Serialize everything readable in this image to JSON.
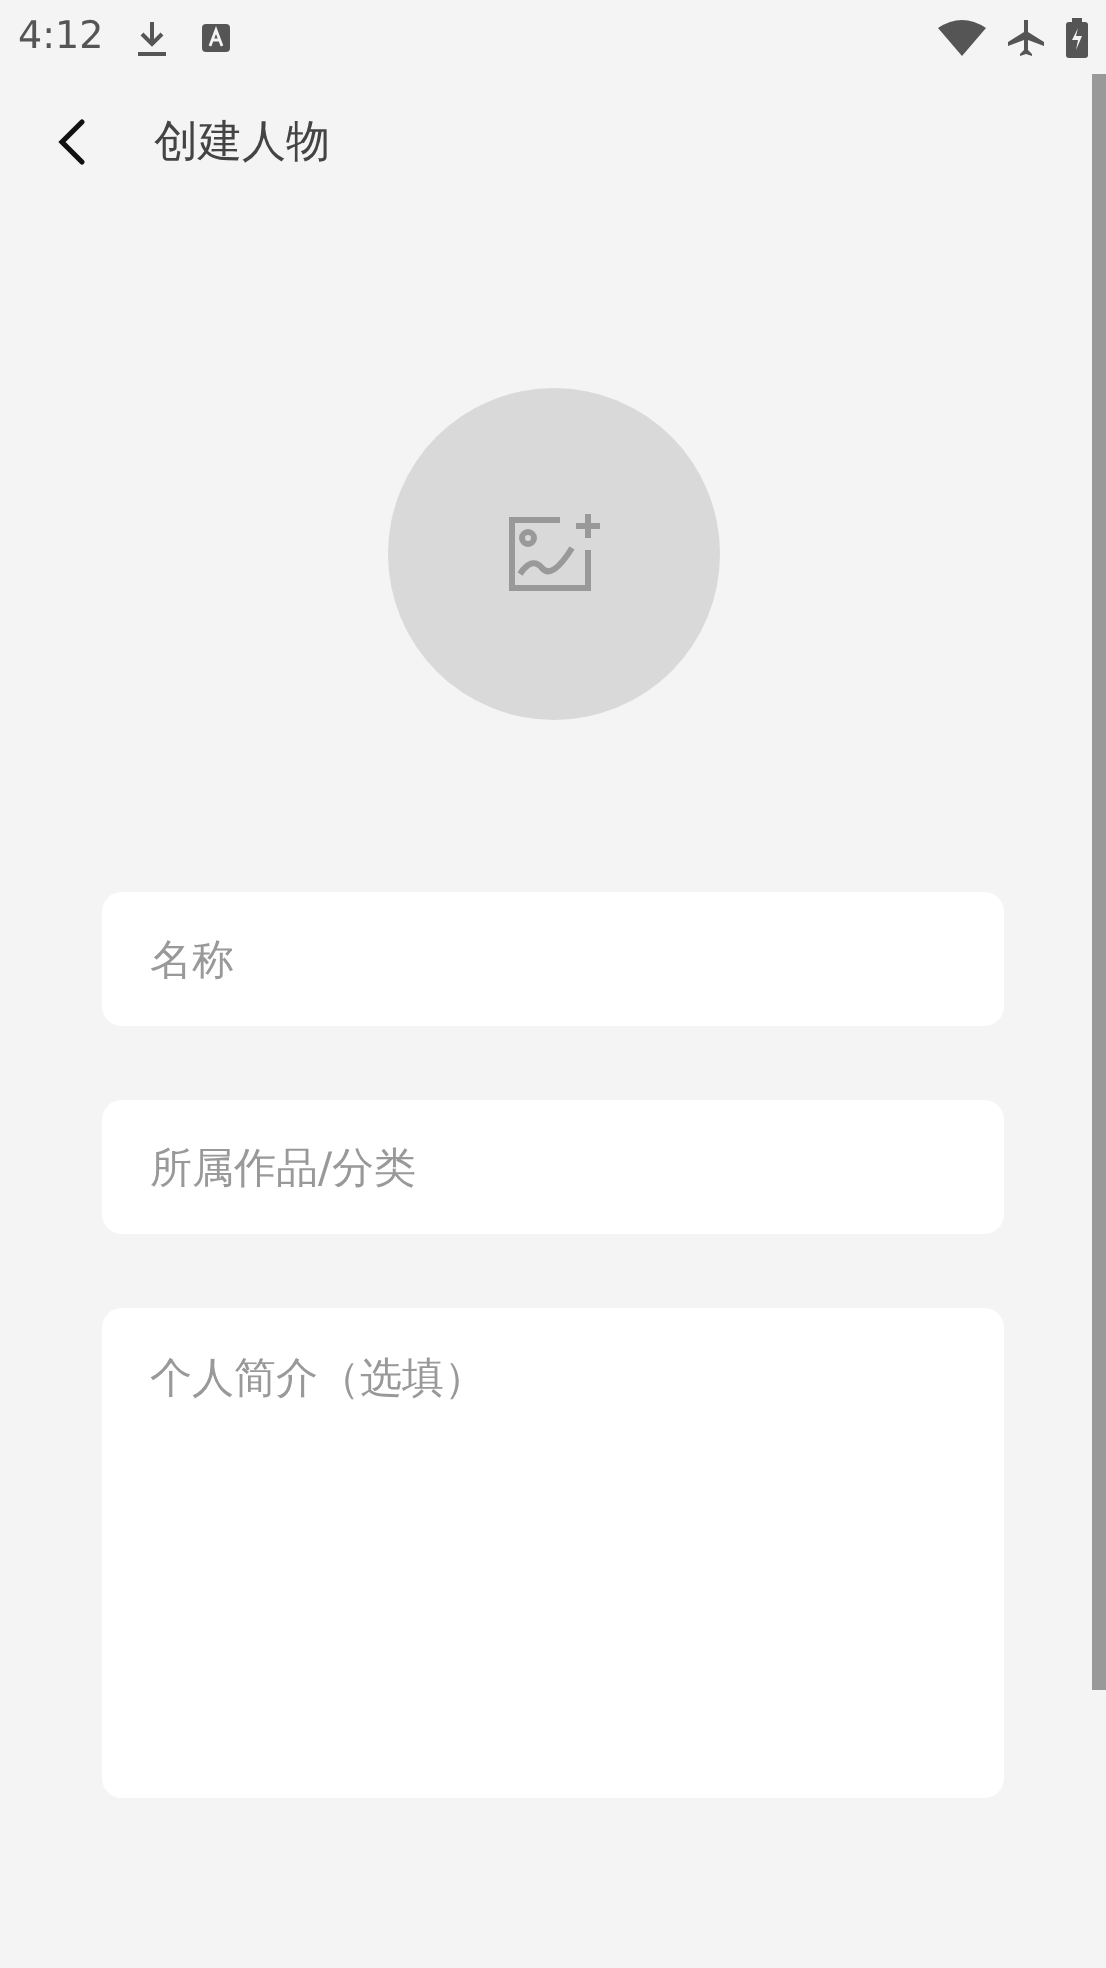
{
  "status_bar": {
    "time": "4:12"
  },
  "header": {
    "title": "创建人物"
  },
  "fields": [
    {
      "kind": "line",
      "placeholder": "名称"
    },
    {
      "kind": "line",
      "placeholder": "所属作品/分类"
    },
    {
      "kind": "area",
      "placeholder": "个人简介（选填）"
    }
  ]
}
